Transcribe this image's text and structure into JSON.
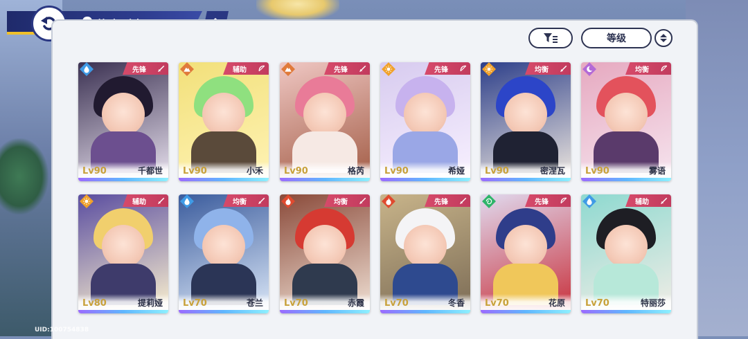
{
  "header": {
    "title": "旅人列表"
  },
  "toolbar": {
    "sort_label": "等级"
  },
  "colors": {
    "header_navy": "#2a3782",
    "accent_yellow": "#f0c02a",
    "role_badge": "#c23b5e",
    "level_gold": "#c8a13a"
  },
  "characters": [
    {
      "name": "千都世",
      "level": "Lv90",
      "role": "先锋",
      "element": "water-drop-icon",
      "weapon": "sword-icon"
    },
    {
      "name": "小禾",
      "level": "Lv90",
      "role": "辅助",
      "element": "mountain-icon",
      "weapon": "bow-icon"
    },
    {
      "name": "格芮",
      "level": "Lv90",
      "role": "先锋",
      "element": "mountain-icon",
      "weapon": "sword-icon"
    },
    {
      "name": "希娅",
      "level": "Lv90",
      "role": "先锋",
      "element": "sun-icon",
      "weapon": "bow-icon"
    },
    {
      "name": "密涅瓦",
      "level": "Lv90",
      "role": "均衡",
      "element": "sun-icon",
      "weapon": "sword-icon"
    },
    {
      "name": "雾语",
      "level": "Lv90",
      "role": "均衡",
      "element": "moon-icon",
      "weapon": "bow-icon"
    },
    {
      "name": "提莉娅",
      "level": "Lv80",
      "role": "辅助",
      "element": "sun-icon",
      "weapon": "sword-icon"
    },
    {
      "name": "苍兰",
      "level": "Lv70",
      "role": "均衡",
      "element": "water-drop-icon",
      "weapon": "sword-icon"
    },
    {
      "name": "赤霞",
      "level": "Lv70",
      "role": "均衡",
      "element": "flame-icon",
      "weapon": "sword-icon"
    },
    {
      "name": "冬香",
      "level": "Lv70",
      "role": "先锋",
      "element": "flame-icon",
      "weapon": "sword-icon"
    },
    {
      "name": "花原",
      "level": "Lv70",
      "role": "先锋",
      "element": "wind-swirl-icon",
      "weapon": "bow-icon"
    },
    {
      "name": "特丽莎",
      "level": "Lv70",
      "role": "辅助",
      "element": "water-drop-icon",
      "weapon": "sword-icon"
    }
  ],
  "footer": {
    "uid": "UID:100754838"
  }
}
